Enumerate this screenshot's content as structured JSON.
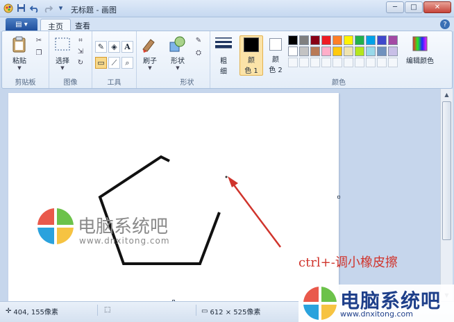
{
  "window": {
    "title": "无标题 - 画图",
    "buttons": {
      "minimize": "─",
      "maximize": "□",
      "close": "✕"
    }
  },
  "quick_access": {
    "icons": [
      "paint-app-icon",
      "save-icon",
      "undo-icon",
      "redo-icon",
      "customize-icon"
    ]
  },
  "tabs": {
    "app_menu": "▤ ▾",
    "home": "主页",
    "view": "查看",
    "help": "?"
  },
  "ribbon": {
    "clipboard": {
      "paste": "粘贴",
      "group_label": "剪贴板"
    },
    "image": {
      "select": "选择",
      "group_label": "图像"
    },
    "tools": {
      "group_label": "工具"
    },
    "brushes": {
      "label": "刷子"
    },
    "shapes": {
      "label": "形状",
      "group_label": "形状"
    },
    "size": {
      "label_1": "粗",
      "label_2": "细"
    },
    "color1": {
      "label_1": "颜",
      "label_2": "色 1"
    },
    "color2": {
      "label_1": "颜",
      "label_2": "色 2"
    },
    "edit_colors": "编辑颜色",
    "colors_group_label": "颜色",
    "palette_row1": [
      "#000000",
      "#7f7f7f",
      "#880015",
      "#ed1c24",
      "#ff7f27",
      "#fff200",
      "#22b14c",
      "#00a2e8",
      "#3f48cc",
      "#a349a4"
    ],
    "palette_row2": [
      "#ffffff",
      "#c3c3c3",
      "#b97a57",
      "#ffaec9",
      "#ffc90e",
      "#efe4b0",
      "#b5e61d",
      "#99d9ea",
      "#7092be",
      "#c8bfe7"
    ],
    "color1_value": "#000000",
    "color2_value": "#ffffff"
  },
  "canvas": {
    "watermark_text": "电脑系统吧",
    "watermark_url": "www.dnxitong.com",
    "annotation": "ctrl+-调小橡皮擦"
  },
  "status": {
    "cursor_pos": "404, 155像素",
    "canvas_size": "612 × 525像素"
  },
  "corner_watermark": {
    "title": "电脑系统吧",
    "url": "www.dnxitong.com"
  }
}
